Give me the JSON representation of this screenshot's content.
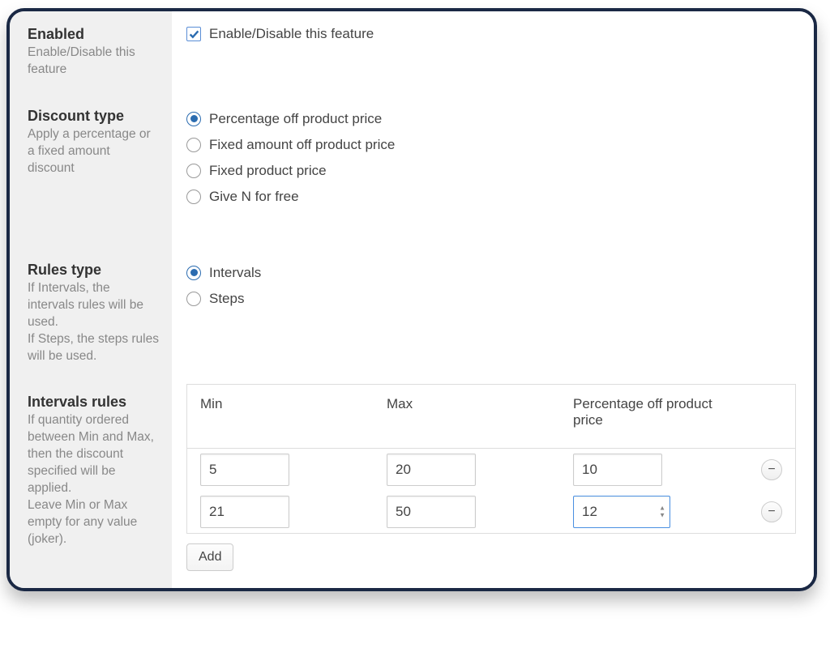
{
  "enabled": {
    "title": "Enabled",
    "desc": "Enable/Disable this feature",
    "checkbox_label": "Enable/Disable this feature",
    "checked": true
  },
  "discount_type": {
    "title": "Discount type",
    "desc": "Apply a percentage or a fixed amount discount",
    "options": [
      "Percentage off product price",
      "Fixed amount off product price",
      "Fixed product price",
      "Give N for free"
    ],
    "selected_index": 0
  },
  "rules_type": {
    "title": "Rules type",
    "desc": "If Intervals, the intervals rules will be used.\nIf Steps, the steps rules will be used.",
    "options": [
      "Intervals",
      "Steps"
    ],
    "selected_index": 0
  },
  "intervals_rules": {
    "title": "Intervals rules",
    "desc": "If quantity ordered between Min and Max, then the discount specified will be applied.\nLeave Min or Max empty for any value (joker).",
    "headers": {
      "min": "Min",
      "max": "Max",
      "pct": "Percentage off product price"
    },
    "rows": [
      {
        "min": "5",
        "max": "20",
        "pct": "10",
        "focused": false
      },
      {
        "min": "21",
        "max": "50",
        "pct": "12",
        "focused": true
      }
    ],
    "add_label": "Add"
  }
}
